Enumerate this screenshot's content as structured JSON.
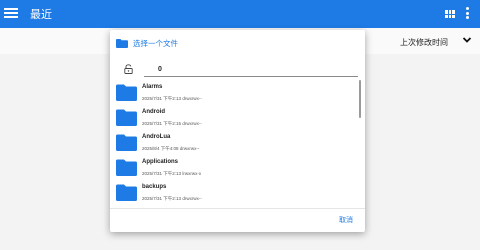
{
  "appbar": {
    "title": "最近",
    "icons": [
      "menu-icon",
      "grid-view-icon",
      "more-vert-icon"
    ],
    "color": "#1e7be6"
  },
  "subbar": {
    "sort_label": "上次修改时间",
    "sort_icon": "chevron-down-icon"
  },
  "dialog": {
    "title": "选择一个文件",
    "path_value": "0",
    "cancel_label": "取消",
    "items": [
      {
        "name": "Alarms",
        "date": "2025/7/31",
        "time": "下午2:13",
        "perms": "drwxrwx--"
      },
      {
        "name": "Android",
        "date": "2025/7/31",
        "time": "下午2:15",
        "perms": "drwxrwx--"
      },
      {
        "name": "AndroLua",
        "date": "2025/8/4",
        "time": "下午4:08",
        "perms": "drwxrwx--"
      },
      {
        "name": "Applications",
        "date": "2025/7/31",
        "time": "下午2:13",
        "perms": "lrwxrwx-x"
      },
      {
        "name": "backups",
        "date": "2025/7/31",
        "time": "下午2:13",
        "perms": "drwxrwx--"
      }
    ]
  }
}
